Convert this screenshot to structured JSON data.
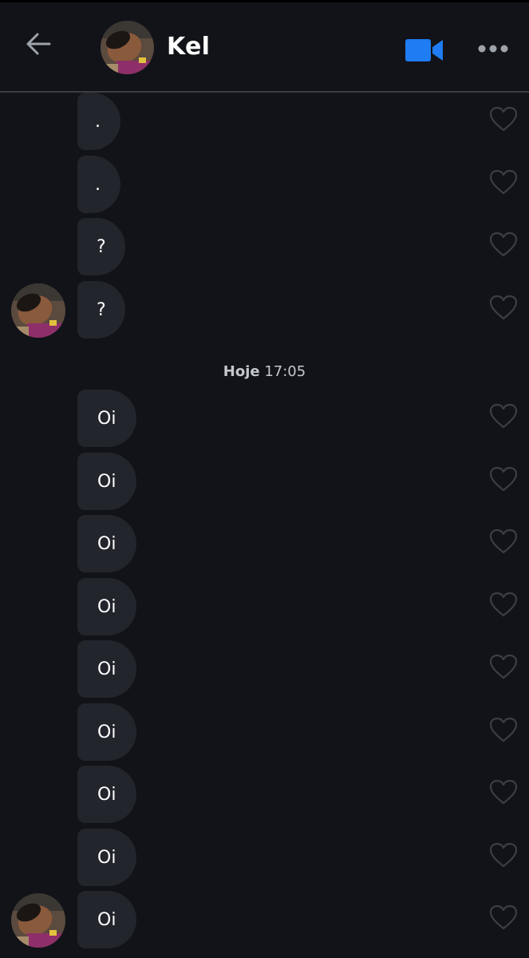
{
  "header": {
    "contact_name": "Kel",
    "icons": {
      "back": "arrow-left-icon",
      "video": "video-camera-icon",
      "more": "more-horizontal-icon"
    },
    "accent_color": "#1f7cf2"
  },
  "conversation": {
    "date_separator": {
      "day": "Hoje",
      "time": "17:05"
    },
    "earlier_messages": [
      {
        "text": "."
      },
      {
        "text": "."
      },
      {
        "text": "?"
      },
      {
        "text": "?"
      }
    ],
    "messages": [
      {
        "text": "Oi"
      },
      {
        "text": "Oi"
      },
      {
        "text": "Oi"
      },
      {
        "text": "Oi"
      },
      {
        "text": "Oi"
      },
      {
        "text": "Oi"
      },
      {
        "text": "Oi"
      },
      {
        "text": "Oi"
      },
      {
        "text": "Oi"
      }
    ],
    "like_icon": "heart-outline-icon"
  }
}
